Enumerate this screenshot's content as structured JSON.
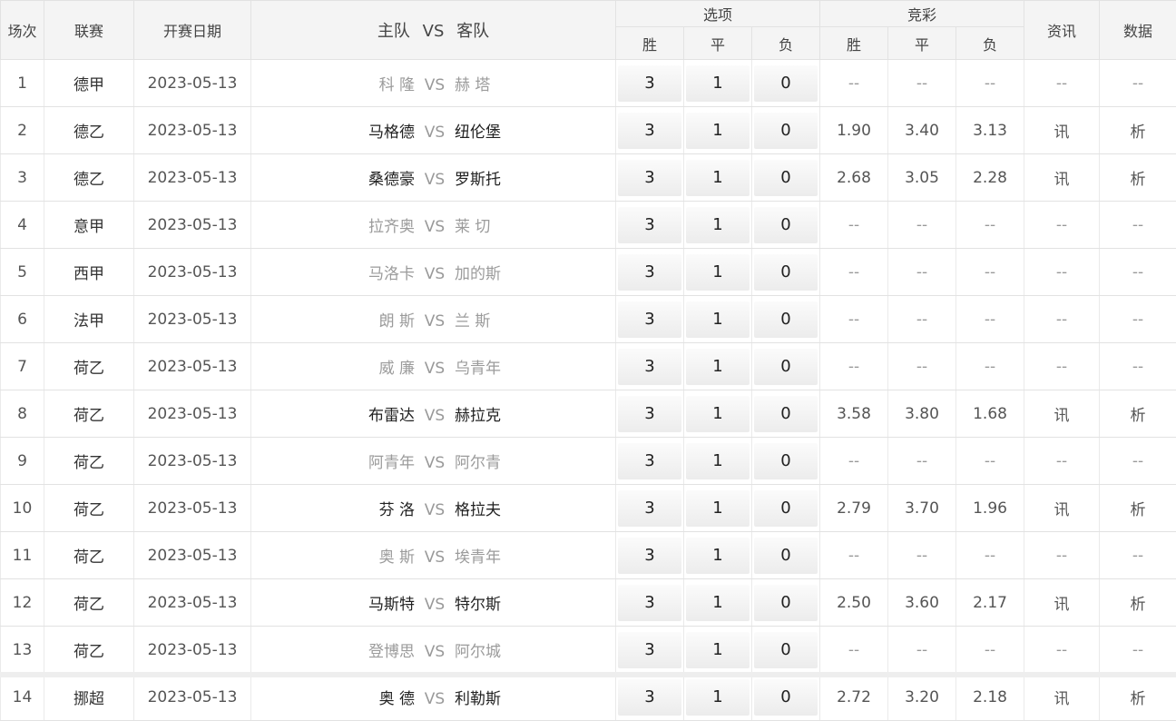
{
  "header": {
    "idx": "场次",
    "league": "联赛",
    "date": "开赛日期",
    "home": "主队",
    "vs": "VS",
    "away": "客队",
    "options": "选项",
    "jingcai": "竞彩",
    "info": "资讯",
    "data": "数据",
    "win": "胜",
    "draw": "平",
    "lose": "负"
  },
  "rows": [
    {
      "idx": "1",
      "league": "德甲",
      "date": "2023-05-13",
      "home": "科 隆",
      "vs": "VS",
      "away": "赫 塔",
      "w": "3",
      "d": "1",
      "l": "0",
      "ow": "--",
      "od": "--",
      "ol": "--",
      "info": "--",
      "data": "--",
      "state": "dim"
    },
    {
      "idx": "2",
      "league": "德乙",
      "date": "2023-05-13",
      "home": "马格德",
      "vs": "VS",
      "away": "纽伦堡",
      "w": "3",
      "d": "1",
      "l": "0",
      "ow": "1.90",
      "od": "3.40",
      "ol": "3.13",
      "info": "讯",
      "data": "析",
      "state": "live"
    },
    {
      "idx": "3",
      "league": "德乙",
      "date": "2023-05-13",
      "home": "桑德豪",
      "vs": "VS",
      "away": "罗斯托",
      "w": "3",
      "d": "1",
      "l": "0",
      "ow": "2.68",
      "od": "3.05",
      "ol": "2.28",
      "info": "讯",
      "data": "析",
      "state": "live"
    },
    {
      "idx": "4",
      "league": "意甲",
      "date": "2023-05-13",
      "home": "拉齐奥",
      "vs": "VS",
      "away": "莱 切",
      "w": "3",
      "d": "1",
      "l": "0",
      "ow": "--",
      "od": "--",
      "ol": "--",
      "info": "--",
      "data": "--",
      "state": "dim"
    },
    {
      "idx": "5",
      "league": "西甲",
      "date": "2023-05-13",
      "home": "马洛卡",
      "vs": "VS",
      "away": "加的斯",
      "w": "3",
      "d": "1",
      "l": "0",
      "ow": "--",
      "od": "--",
      "ol": "--",
      "info": "--",
      "data": "--",
      "state": "dim"
    },
    {
      "idx": "6",
      "league": "法甲",
      "date": "2023-05-13",
      "home": "朗 斯",
      "vs": "VS",
      "away": "兰 斯",
      "w": "3",
      "d": "1",
      "l": "0",
      "ow": "--",
      "od": "--",
      "ol": "--",
      "info": "--",
      "data": "--",
      "state": "dim"
    },
    {
      "idx": "7",
      "league": "荷乙",
      "date": "2023-05-13",
      "home": "威 廉",
      "vs": "VS",
      "away": "乌青年",
      "w": "3",
      "d": "1",
      "l": "0",
      "ow": "--",
      "od": "--",
      "ol": "--",
      "info": "--",
      "data": "--",
      "state": "dim"
    },
    {
      "idx": "8",
      "league": "荷乙",
      "date": "2023-05-13",
      "home": "布雷达",
      "vs": "VS",
      "away": "赫拉克",
      "w": "3",
      "d": "1",
      "l": "0",
      "ow": "3.58",
      "od": "3.80",
      "ol": "1.68",
      "info": "讯",
      "data": "析",
      "state": "live"
    },
    {
      "idx": "9",
      "league": "荷乙",
      "date": "2023-05-13",
      "home": "阿青年",
      "vs": "VS",
      "away": "阿尔青",
      "w": "3",
      "d": "1",
      "l": "0",
      "ow": "--",
      "od": "--",
      "ol": "--",
      "info": "--",
      "data": "--",
      "state": "dim"
    },
    {
      "idx": "10",
      "league": "荷乙",
      "date": "2023-05-13",
      "home": "芬 洛",
      "vs": "VS",
      "away": "格拉夫",
      "w": "3",
      "d": "1",
      "l": "0",
      "ow": "2.79",
      "od": "3.70",
      "ol": "1.96",
      "info": "讯",
      "data": "析",
      "state": "live"
    },
    {
      "idx": "11",
      "league": "荷乙",
      "date": "2023-05-13",
      "home": "奥 斯",
      "vs": "VS",
      "away": "埃青年",
      "w": "3",
      "d": "1",
      "l": "0",
      "ow": "--",
      "od": "--",
      "ol": "--",
      "info": "--",
      "data": "--",
      "state": "dim"
    },
    {
      "idx": "12",
      "league": "荷乙",
      "date": "2023-05-13",
      "home": "马斯特",
      "vs": "VS",
      "away": "特尔斯",
      "w": "3",
      "d": "1",
      "l": "0",
      "ow": "2.50",
      "od": "3.60",
      "ol": "2.17",
      "info": "讯",
      "data": "析",
      "state": "live"
    },
    {
      "idx": "13",
      "league": "荷乙",
      "date": "2023-05-13",
      "home": "登博思",
      "vs": "VS",
      "away": "阿尔城",
      "w": "3",
      "d": "1",
      "l": "0",
      "ow": "--",
      "od": "--",
      "ol": "--",
      "info": "--",
      "data": "--",
      "state": "dim"
    },
    {
      "idx": "14",
      "league": "挪超",
      "date": "2023-05-13",
      "home": "奥 德",
      "vs": "VS",
      "away": "利勒斯",
      "w": "3",
      "d": "1",
      "l": "0",
      "ow": "2.72",
      "od": "3.20",
      "ol": "2.18",
      "info": "讯",
      "data": "析",
      "state": "live"
    }
  ]
}
